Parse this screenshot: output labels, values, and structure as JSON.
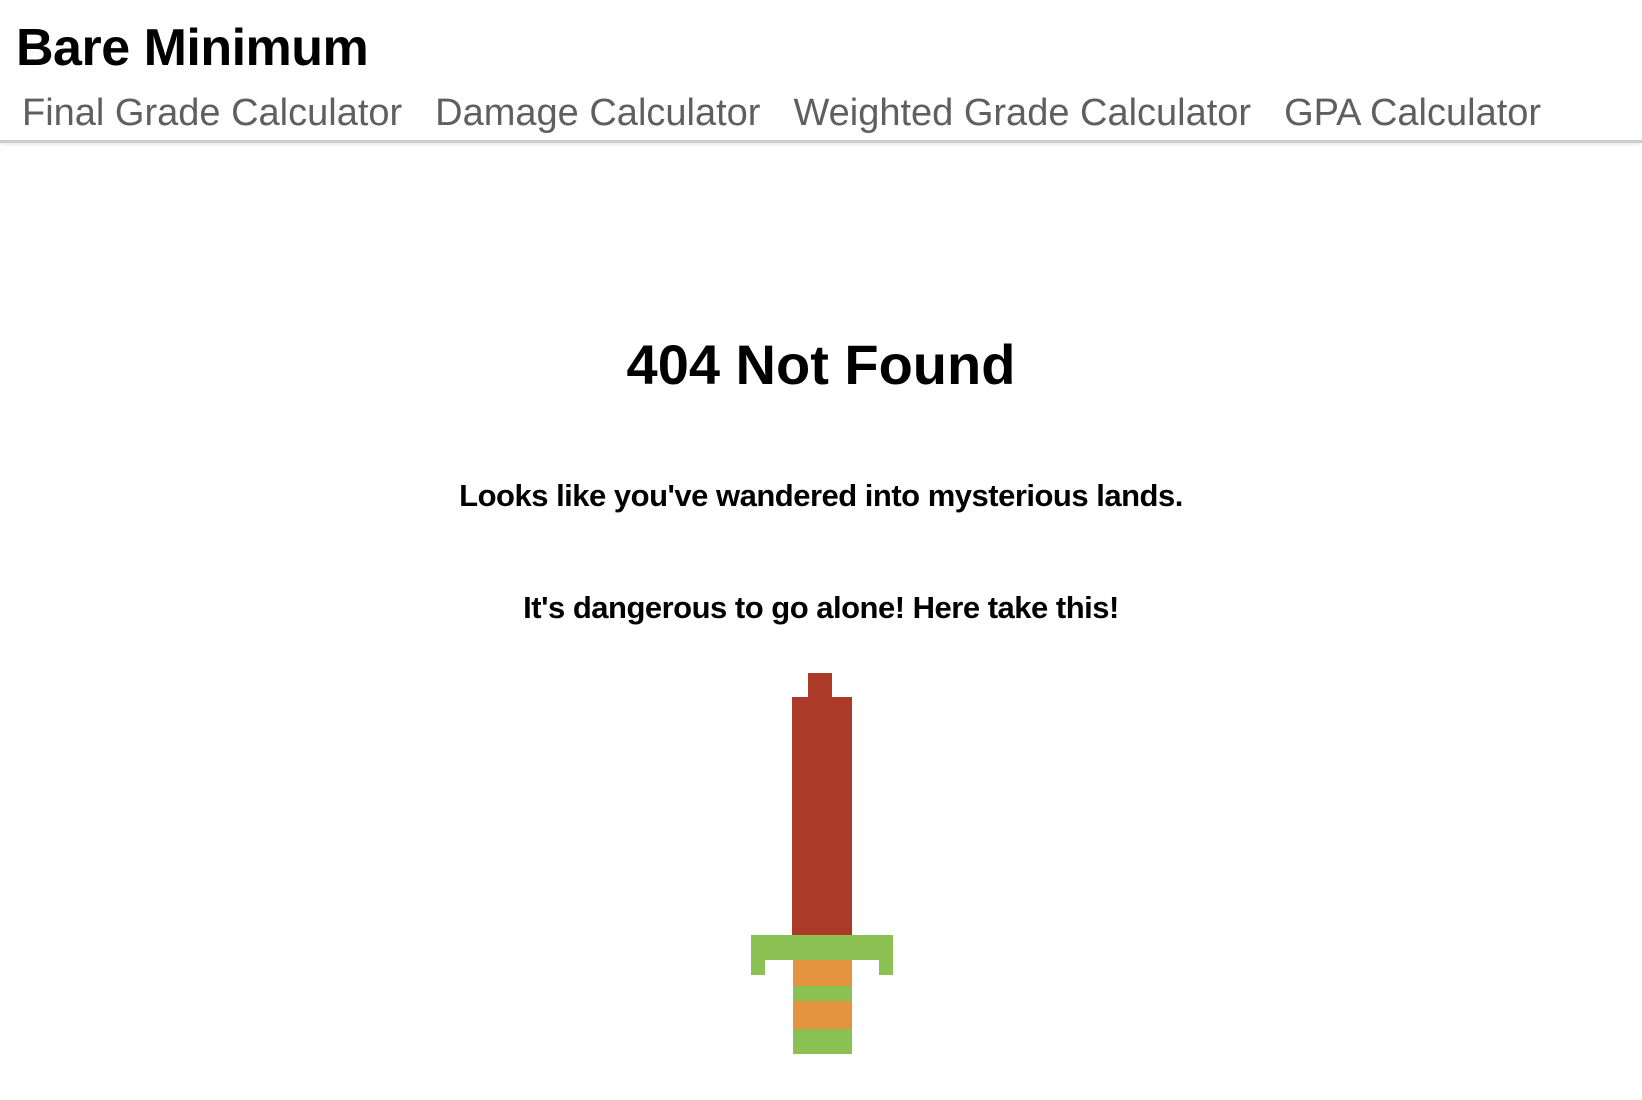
{
  "header": {
    "brand": "Bare Minimum",
    "nav": [
      {
        "label": "Final Grade Calculator"
      },
      {
        "label": "Damage Calculator"
      },
      {
        "label": "Weighted Grade Calculator"
      },
      {
        "label": "GPA Calculator"
      }
    ]
  },
  "main": {
    "heading": "404 Not Found",
    "message_1": "Looks like you've wandered into mysterious lands.",
    "message_2": "It's dangerous to go alone! Here take this!"
  },
  "sword": {
    "icon": "sword-icon",
    "colors": {
      "blade": "#ac3a28",
      "guard": "#8bc052",
      "grip": "#e4933f"
    }
  }
}
